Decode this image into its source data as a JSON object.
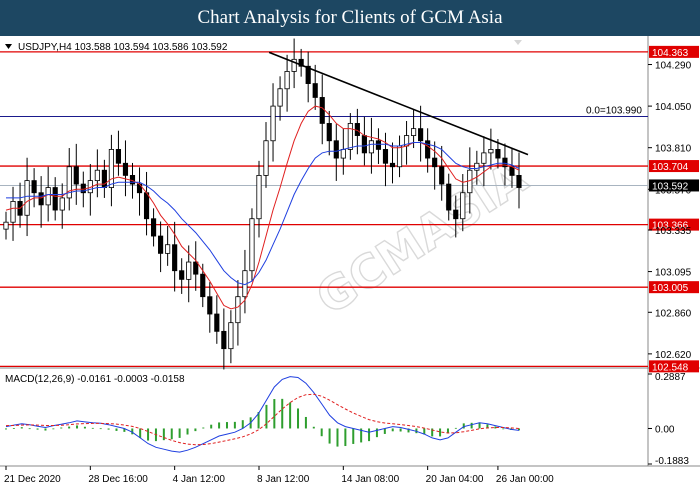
{
  "banner": {
    "title": "Chart Analysis for Clients of GCM Asia"
  },
  "chart_data": {
    "type": "line",
    "symbol_header": "USDJPY,H4  103.588 103.594 103.586 103.592",
    "price_axis_labels": [
      "104.290",
      "104.050",
      "103.810",
      "103.570",
      "103.335",
      "103.095",
      "102.860",
      "102.620"
    ],
    "ylim": [
      102.55,
      104.42
    ],
    "horizontal_levels": [
      {
        "value": 104.363,
        "label": "104.363",
        "color": "#e00000"
      },
      {
        "value": 103.704,
        "label": "103.704",
        "color": "#e00000"
      },
      {
        "value": 103.366,
        "label": "103.366",
        "color": "#e00000"
      },
      {
        "value": 103.005,
        "label": "103.005",
        "color": "#e00000"
      },
      {
        "value": 102.548,
        "label": "102.548",
        "color": "#e00000"
      }
    ],
    "fib_level": {
      "value": 103.99,
      "label": "0.0=103.990",
      "color": "#1a1a8c"
    },
    "current_price": {
      "value": 103.592,
      "label": "103.592"
    },
    "x_tick_labels": [
      "21 Dec 2020",
      "28 Dec 16:00",
      "4 Jan 12:00",
      "8 Jan 12:00",
      "14 Jan 08:00",
      "20 Jan 04:00",
      "26 Jan 00:00"
    ],
    "series": [
      {
        "name": "Close",
        "values": [
          103.38,
          103.5,
          103.42,
          103.62,
          103.55,
          103.48,
          103.58,
          103.45,
          103.52,
          103.7,
          103.6,
          103.55,
          103.62,
          103.68,
          103.58,
          103.8,
          103.72,
          103.65,
          103.6,
          103.55,
          103.4,
          103.3,
          103.2,
          103.25,
          103.1,
          103.05,
          103.15,
          103.08,
          102.95,
          102.85,
          102.75,
          102.65,
          102.8,
          102.95,
          103.1,
          103.4,
          103.65,
          103.85,
          104.05,
          104.15,
          104.25,
          104.32,
          104.28,
          104.18,
          104.1,
          103.95,
          103.85,
          103.75,
          103.8,
          103.95,
          103.88,
          103.78,
          103.85,
          103.8,
          103.72,
          103.7,
          103.82,
          103.88,
          103.92,
          103.85,
          103.75,
          103.7,
          103.6,
          103.45,
          103.4,
          103.55,
          103.68,
          103.72,
          103.78,
          103.8,
          103.75,
          103.7,
          103.65,
          103.58
        ]
      },
      {
        "name": "Moving average (fast)",
        "values": [
          103.45,
          103.46,
          103.46,
          103.5,
          103.52,
          103.52,
          103.54,
          103.53,
          103.53,
          103.56,
          103.57,
          103.57,
          103.58,
          103.6,
          103.6,
          103.63,
          103.64,
          103.63,
          103.62,
          103.6,
          103.55,
          103.49,
          103.42,
          103.37,
          103.31,
          103.24,
          103.2,
          103.16,
          103.1,
          103.04,
          102.97,
          102.9,
          102.88,
          102.89,
          102.93,
          103.02,
          103.15,
          103.3,
          103.45,
          103.58,
          103.72,
          103.85,
          103.95,
          104.02,
          104.05,
          104.04,
          104.0,
          103.95,
          103.92,
          103.92,
          103.91,
          103.88,
          103.87,
          103.86,
          103.84,
          103.81,
          103.81,
          103.82,
          103.84,
          103.84,
          103.82,
          103.79,
          103.75,
          103.69,
          103.63,
          103.61,
          103.62,
          103.64,
          103.67,
          103.7,
          103.71,
          103.71,
          103.7,
          103.68
        ]
      },
      {
        "name": "Moving average (slow)",
        "values": [
          103.52,
          103.52,
          103.52,
          103.53,
          103.53,
          103.53,
          103.54,
          103.54,
          103.54,
          103.55,
          103.56,
          103.56,
          103.57,
          103.58,
          103.58,
          103.6,
          103.61,
          103.61,
          103.61,
          103.61,
          103.59,
          103.56,
          103.52,
          103.49,
          103.45,
          103.4,
          103.36,
          103.32,
          103.27,
          103.22,
          103.16,
          103.1,
          103.06,
          103.03,
          103.02,
          103.04,
          103.09,
          103.16,
          103.25,
          103.34,
          103.44,
          103.54,
          103.62,
          103.69,
          103.75,
          103.78,
          103.79,
          103.79,
          103.8,
          103.81,
          103.82,
          103.82,
          103.83,
          103.83,
          103.83,
          103.82,
          103.82,
          103.83,
          103.84,
          103.84,
          103.83,
          103.82,
          103.8,
          103.76,
          103.72,
          103.7,
          103.69,
          103.69,
          103.7,
          103.71,
          103.72,
          103.72,
          103.71,
          103.69
        ]
      }
    ],
    "macd": {
      "header": "MACD(12,26,9) -0.0161 -0.0003 -0.0158",
      "axis_labels": [
        "0.2887",
        "0.00",
        "-0.1883"
      ],
      "ylim": [
        -0.1883,
        0.2887
      ],
      "main": [
        0.01,
        0.018,
        0.025,
        0.02,
        0.012,
        0.005,
        0.015,
        0.022,
        0.03,
        0.04,
        0.035,
        0.03,
        0.028,
        0.02,
        0.01,
        0.0,
        -0.02,
        -0.05,
        -0.08,
        -0.1,
        -0.11,
        -0.12,
        -0.125,
        -0.115,
        -0.1,
        -0.08,
        -0.06,
        -0.04,
        -0.03,
        -0.02,
        0.0,
        0.03,
        0.08,
        0.15,
        0.22,
        0.26,
        0.275,
        0.27,
        0.24,
        0.19,
        0.13,
        0.07,
        0.03,
        0.01,
        0.0,
        -0.01,
        -0.02,
        -0.01,
        0.0,
        0.01,
        0.005,
        -0.005,
        -0.015,
        -0.03,
        -0.05,
        -0.06,
        -0.05,
        -0.02,
        0.01,
        0.02,
        0.03,
        0.025,
        0.015,
        0.005,
        -0.005,
        -0.01
      ],
      "signal": [
        0.015,
        0.016,
        0.018,
        0.019,
        0.018,
        0.016,
        0.016,
        0.017,
        0.02,
        0.024,
        0.026,
        0.027,
        0.027,
        0.026,
        0.023,
        0.018,
        0.011,
        0.0,
        -0.016,
        -0.033,
        -0.048,
        -0.063,
        -0.075,
        -0.083,
        -0.086,
        -0.085,
        -0.08,
        -0.072,
        -0.064,
        -0.055,
        -0.044,
        -0.029,
        -0.007,
        0.025,
        0.064,
        0.103,
        0.137,
        0.164,
        0.179,
        0.181,
        0.171,
        0.15,
        0.126,
        0.103,
        0.082,
        0.064,
        0.047,
        0.036,
        0.029,
        0.025,
        0.021,
        0.016,
        0.01,
        0.002,
        -0.008,
        -0.018,
        -0.024,
        -0.023,
        -0.017,
        -0.01,
        -0.002,
        0.003,
        0.005,
        0.005,
        0.003,
        0.0
      ]
    },
    "trendline": {
      "color": "#000000"
    },
    "colors": {
      "bull_candle": "#ffffff",
      "bear_candle": "#000000",
      "fast_ma": "#e02020",
      "slow_ma": "#1f3fe0",
      "macd_main": "#1f3fe0",
      "macd_signal": "#e02020",
      "histogram": "#2e9e2e"
    },
    "watermark": "GCMASIA"
  }
}
